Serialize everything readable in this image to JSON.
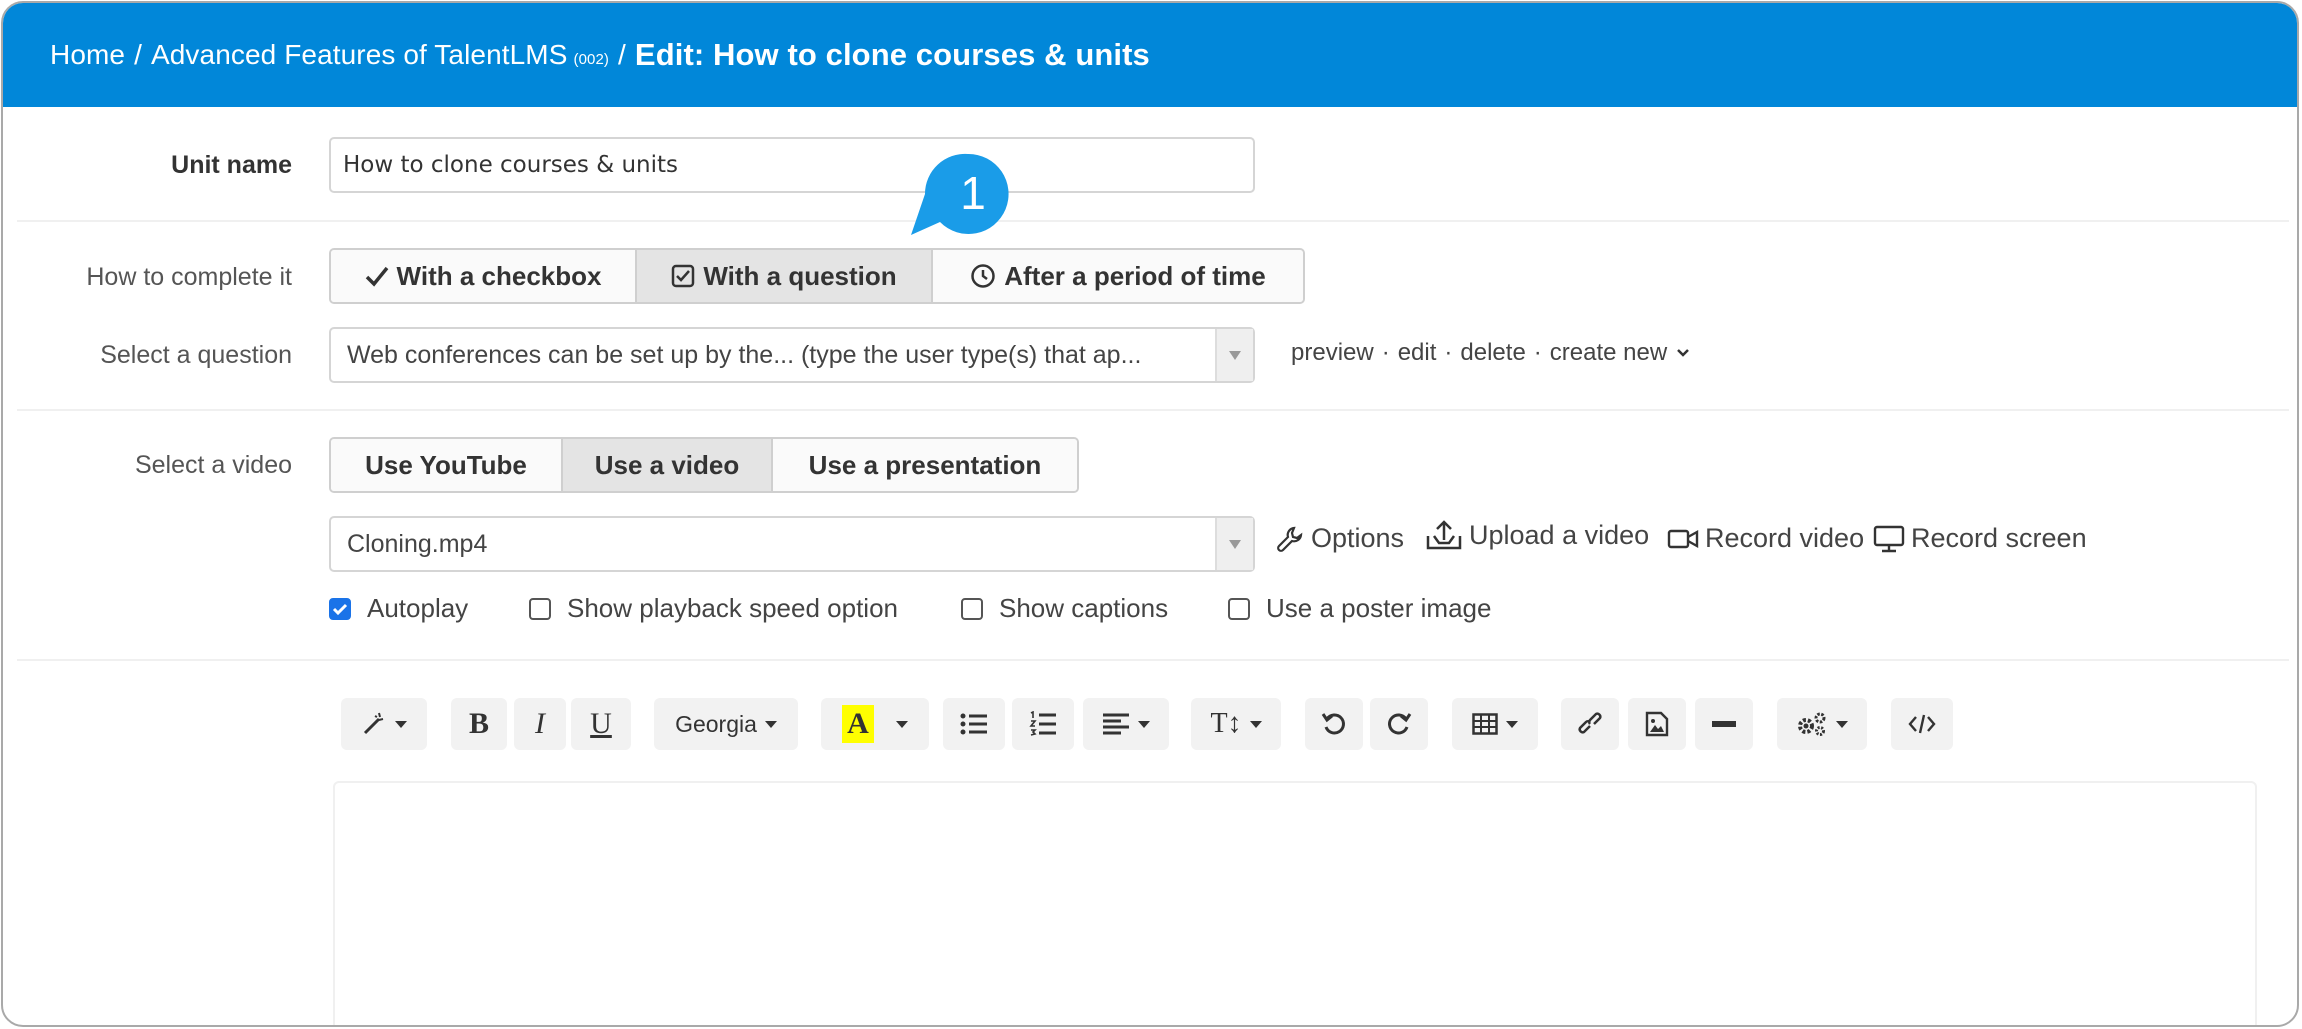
{
  "breadcrumb": {
    "home": "Home",
    "separator": "/",
    "course": "Advanced Features of TalentLMS",
    "course_code": "(002)",
    "current": "Edit: How to clone courses & units"
  },
  "unit_name": {
    "label": "Unit name",
    "value": "How to clone courses & units"
  },
  "completion": {
    "label": "How to complete it",
    "options": [
      "With a checkbox",
      "With a question",
      "After a period of time"
    ],
    "selected": "With a question"
  },
  "question": {
    "label": "Select a question",
    "value": "Web conferences can be set up by the... (type the user type(s) that ap...",
    "links": [
      "preview",
      "edit",
      "delete",
      "create new"
    ],
    "link_separator": "·"
  },
  "video": {
    "label": "Select a video",
    "sources": [
      "Use YouTube",
      "Use a video",
      "Use a presentation"
    ],
    "selected_source": "Use a video",
    "file": "Cloning.mp4",
    "actions": [
      "Options",
      "Upload a video",
      "Record video",
      "Record screen"
    ],
    "checkboxes": [
      {
        "label": "Autoplay",
        "checked": true
      },
      {
        "label": "Show playback speed option",
        "checked": false
      },
      {
        "label": "Show captions",
        "checked": false
      },
      {
        "label": "Use a poster image",
        "checked": false
      }
    ]
  },
  "toolbar": {
    "font": "Georgia",
    "bold": "B",
    "italic": "I",
    "underline": "U",
    "color_letter": "A",
    "text_size": "T↕"
  },
  "callout": {
    "number": "1",
    "color": "#1a9ce8"
  },
  "colors": {
    "header": "#0187d9",
    "checkbox": "#1a73e8",
    "highlight": "#ffff00"
  }
}
